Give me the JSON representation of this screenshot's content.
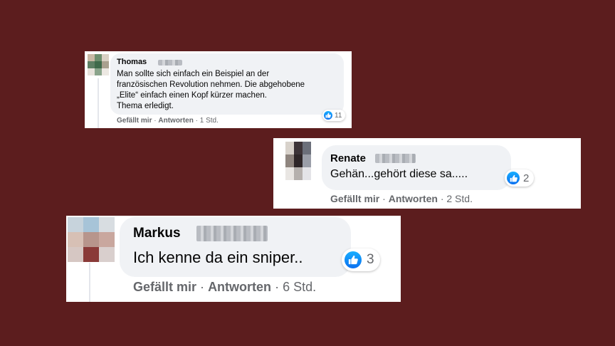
{
  "comments": [
    {
      "author": "Thomas",
      "lines": [
        "Man sollte sich einfach ein Beispiel an der",
        "französischen Revolution nehmen. Die abgehobene",
        "„Elite“ einfach einen Kopf kürzer machen.",
        "Thema erledigt."
      ],
      "reaction_icon": "like-icon",
      "reaction_count": "11",
      "like_label": "Gefällt mir",
      "reply_label": "Antworten",
      "separator": "·",
      "time": "1 Std."
    },
    {
      "author": "Renate",
      "lines": [
        "Gehän...gehört diese sa....."
      ],
      "reaction_icon": "like-icon",
      "reaction_count": "2",
      "like_label": "Gefällt mir",
      "reply_label": "Antworten",
      "separator": "·",
      "time": "2 Std."
    },
    {
      "author": "Markus",
      "lines": [
        "Ich kenne da ein sniper.."
      ],
      "reaction_icon": "like-icon",
      "reaction_count": "3",
      "like_label": "Gefällt mir",
      "reply_label": "Antworten",
      "separator": "·",
      "time": "6 Std."
    }
  ],
  "colors": {
    "background": "#5c1d1e",
    "bubble": "#f0f2f5",
    "meta_text": "#65676b",
    "like_blue": "#1877f2"
  }
}
